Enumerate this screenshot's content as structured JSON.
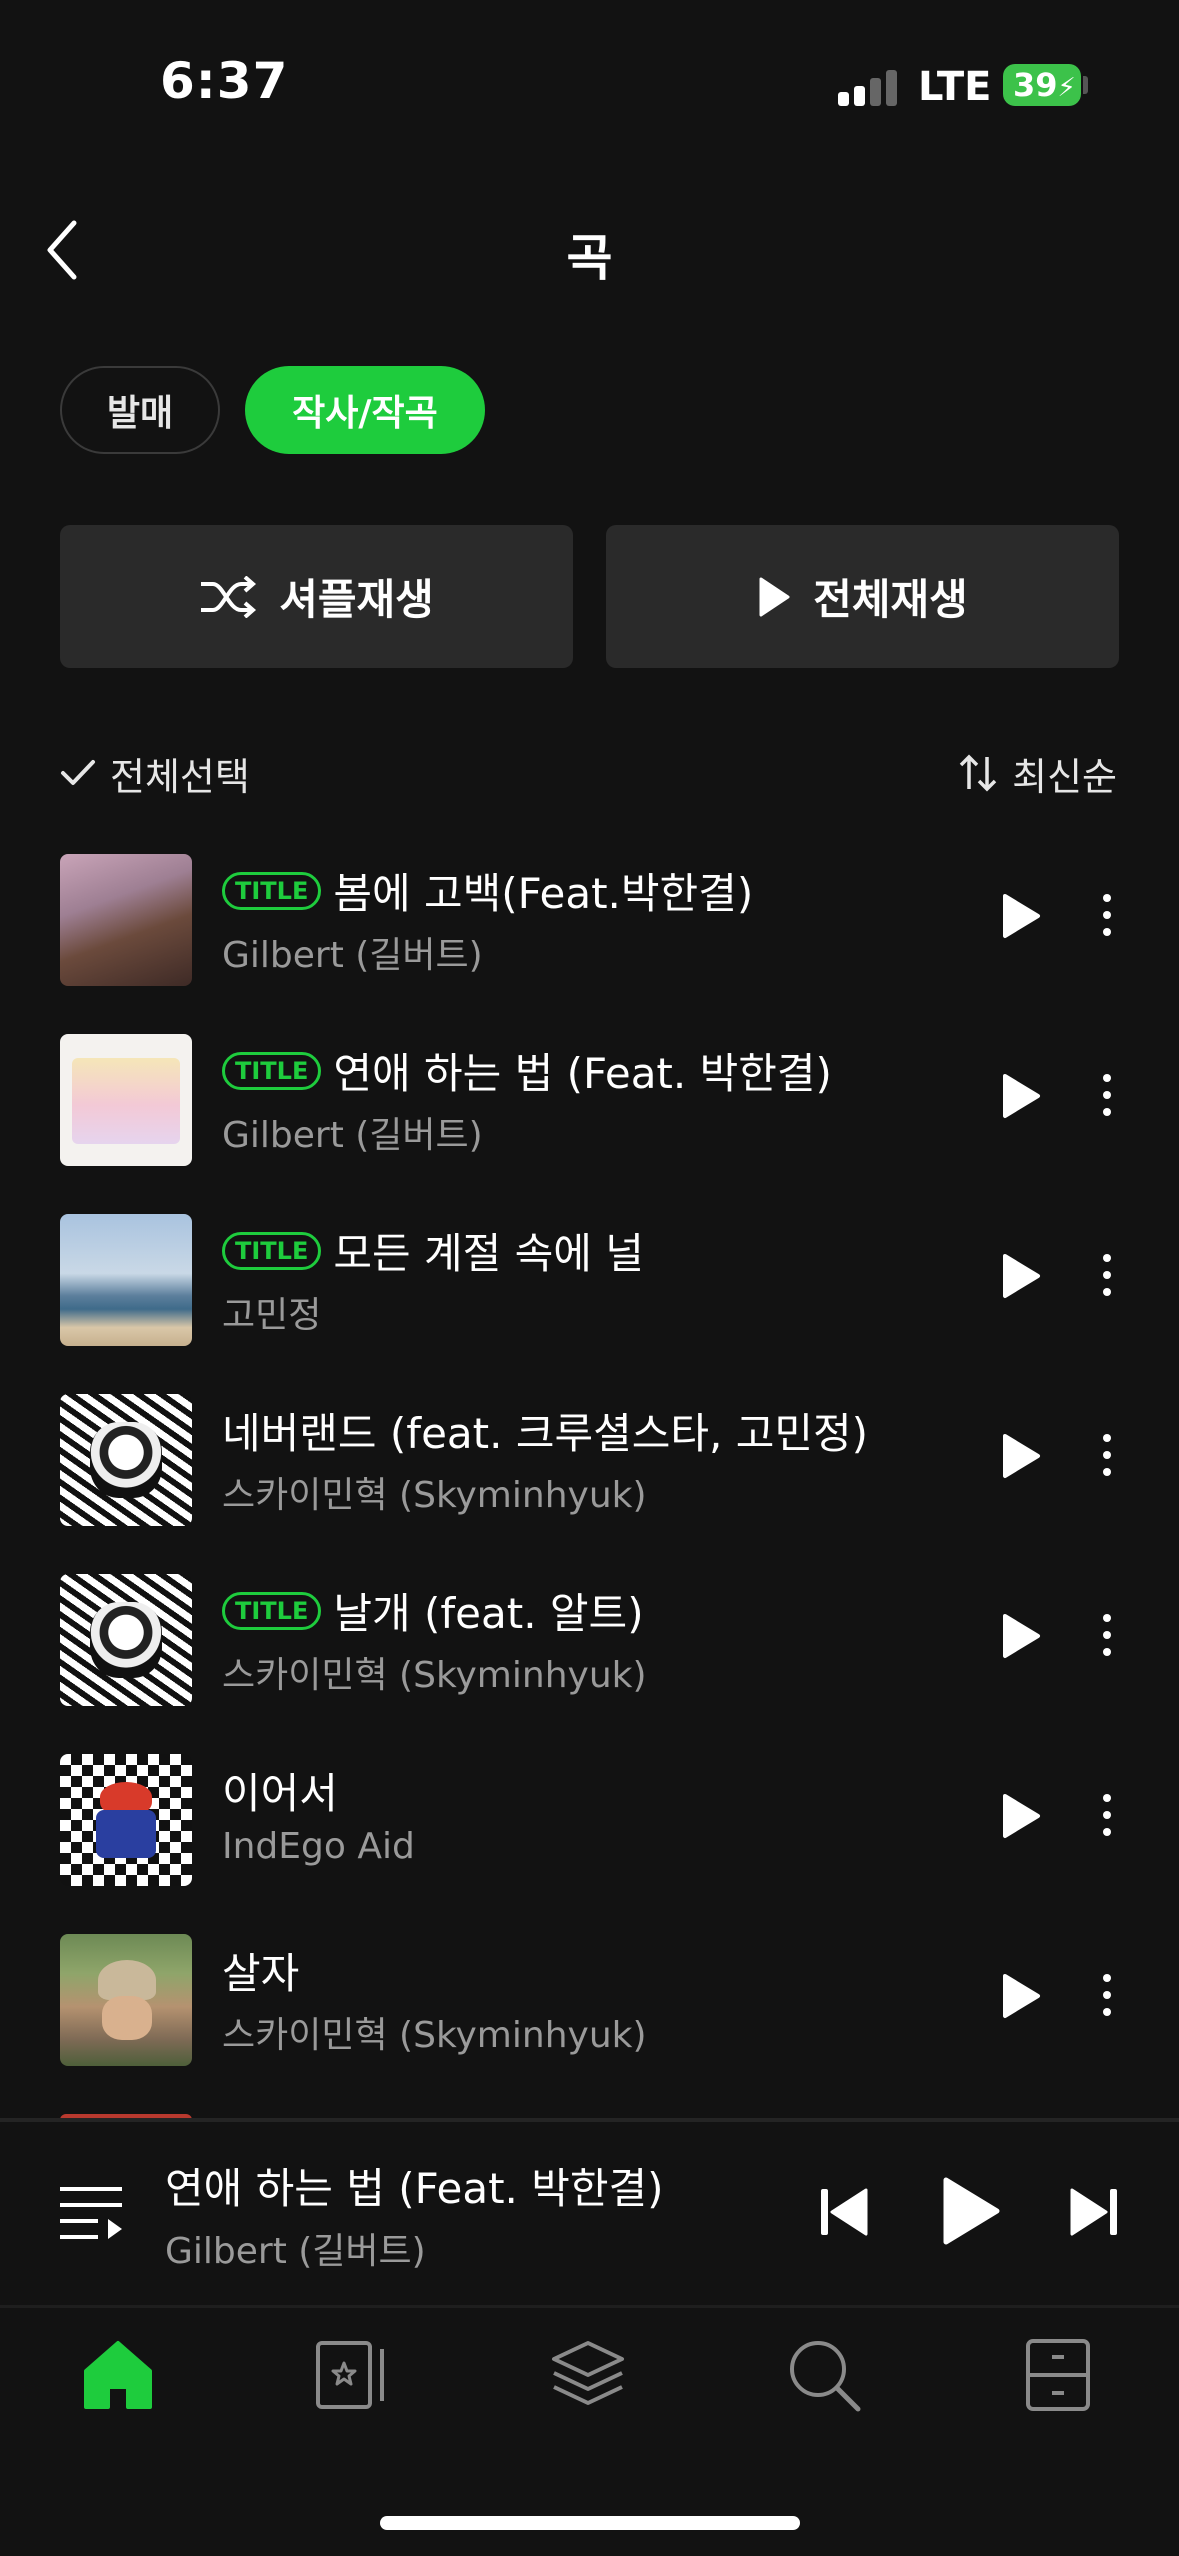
{
  "status": {
    "time": "6:37",
    "network": "LTE",
    "battery": "39"
  },
  "header": {
    "title": "곡"
  },
  "filters": [
    {
      "label": "발매",
      "active": false
    },
    {
      "label": "작사/작곡",
      "active": true
    }
  ],
  "actions": {
    "shuffle_label": "셔플재생",
    "play_all_label": "전체재생"
  },
  "list_controls": {
    "select_all_label": "전체선택",
    "sort_label": "최신순"
  },
  "title_badge": "TITLE",
  "songs": [
    {
      "title": "봄에 고백(Feat.박한결)",
      "artist": "Gilbert (길버트)",
      "is_title": true
    },
    {
      "title": "연애 하는 법 (Feat. 박한결)",
      "artist": "Gilbert (길버트)",
      "is_title": true
    },
    {
      "title": "모든 계절 속에 널",
      "artist": "고민정",
      "is_title": true
    },
    {
      "title": "네버랜드 (feat. 크루셜스타, 고민정)",
      "artist": "스카이민혁 (Skyminhyuk)",
      "is_title": false
    },
    {
      "title": "날개 (feat. 알트)",
      "artist": "스카이민혁 (Skyminhyuk)",
      "is_title": true
    },
    {
      "title": "이어서",
      "artist": "IndEgo Aid",
      "is_title": false
    },
    {
      "title": "살자",
      "artist": "스카이민혁 (Skyminhyuk)",
      "is_title": false
    }
  ],
  "now_playing": {
    "title": "연애 하는 법 (Feat. 박한결)",
    "artist": "Gilbert (길버트)"
  },
  "tabs": [
    {
      "icon": "home-icon",
      "active": true
    },
    {
      "icon": "library-card-icon",
      "active": false
    },
    {
      "icon": "layers-icon",
      "active": false
    },
    {
      "icon": "search-icon",
      "active": false
    },
    {
      "icon": "drawer-icon",
      "active": false
    }
  ],
  "colors": {
    "accent": "#1ecc3d",
    "background": "#121212",
    "button": "#2a2a2a",
    "secondary_text": "#9a9a9a"
  }
}
